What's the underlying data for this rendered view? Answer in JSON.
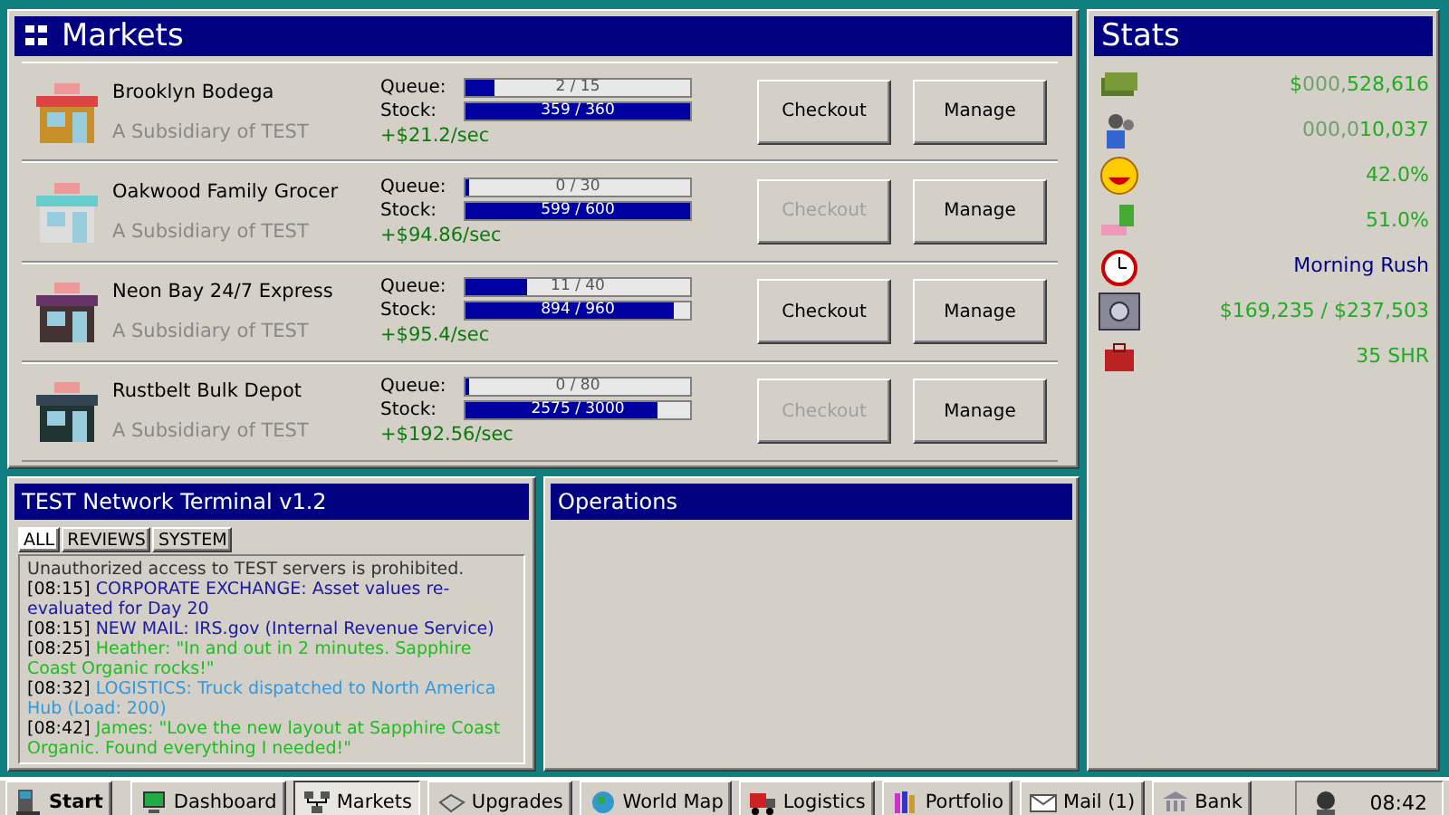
{
  "markets": {
    "title": "Markets",
    "stores": [
      {
        "kind": "bodega",
        "name": "Brooklyn Bodega",
        "subtitle": "A Subsidiary of TEST",
        "queue": {
          "label": "Queue:",
          "text": "2 / 15",
          "level": 0.133
        },
        "stock": {
          "label": "Stock:",
          "text": "359 / 360",
          "level": 0.997
        },
        "income": "+$21.2/sec",
        "checkout": "Checkout",
        "checkout_disabled": false,
        "manage": "Manage"
      },
      {
        "kind": "grocer",
        "name": "Oakwood Family Grocer",
        "subtitle": "A Subsidiary of TEST",
        "queue": {
          "label": "Queue:",
          "text": "0 / 30",
          "level": 0
        },
        "stock": {
          "label": "Stock:",
          "text": "599 / 600",
          "level": 0.998
        },
        "income": "+$94.86/sec",
        "checkout": "Checkout",
        "checkout_disabled": true,
        "manage": "Manage"
      },
      {
        "kind": "express",
        "name": "Neon Bay 24/7 Express",
        "subtitle": "A Subsidiary of TEST",
        "queue": {
          "label": "Queue:",
          "text": "11 / 40",
          "level": 0.275
        },
        "stock": {
          "label": "Stock:",
          "text": "894 / 960",
          "level": 0.931
        },
        "income": "+$95.4/sec",
        "checkout": "Checkout",
        "checkout_disabled": false,
        "manage": "Manage"
      },
      {
        "kind": "depot",
        "name": "Rustbelt Bulk Depot",
        "subtitle": "A Subsidiary of TEST",
        "queue": {
          "label": "Queue:",
          "text": "0 / 80",
          "level": 0
        },
        "stock": {
          "label": "Stock:",
          "text": "2575 / 3000",
          "level": 0.858
        },
        "income": "+$192.56/sec",
        "checkout": "Checkout",
        "checkout_disabled": true,
        "manage": "Manage"
      }
    ]
  },
  "stats": {
    "title": "Stats",
    "items": [
      {
        "kind": "money",
        "parts": [
          {
            "text": "$",
            "faded": false
          },
          {
            "text": "000,",
            "faded": true
          },
          {
            "text": "528,616",
            "faded": false
          }
        ]
      },
      {
        "kind": "money",
        "parts": [
          {
            "text": "000,0",
            "faded": true
          },
          {
            "text": "10,037",
            "faded": false
          }
        ]
      },
      {
        "kind": "money",
        "parts": [
          {
            "text": "42.0%",
            "faded": false
          }
        ]
      },
      {
        "kind": "money",
        "parts": [
          {
            "text": "51.0%",
            "faded": false
          }
        ]
      },
      {
        "kind": "phase",
        "parts": [
          {
            "text": "Morning Rush",
            "faded": false
          }
        ]
      },
      {
        "kind": "money",
        "parts": [
          {
            "text": "$169,235 / $237,503",
            "faded": false
          }
        ]
      },
      {
        "kind": "money",
        "parts": [
          {
            "text": "35 SHR",
            "faded": false
          }
        ]
      }
    ]
  },
  "terminal": {
    "title": "TEST Network Terminal v1.2",
    "tabs": [
      {
        "label": "ALL",
        "selected": true
      },
      {
        "label": "REVIEWS",
        "selected": false
      },
      {
        "label": "SYSTEM",
        "selected": false
      }
    ],
    "lines": [
      {
        "kind": "plain",
        "text": "Unauthorized access to TEST servers is prohibited."
      },
      {
        "kind": "system",
        "time": "[08:15]",
        "text": "CORPORATE EXCHANGE: Asset values re-evaluated for Day 20"
      },
      {
        "kind": "system",
        "time": "[08:15]",
        "text": "NEW MAIL: IRS.gov (Internal Revenue Service)"
      },
      {
        "kind": "review",
        "time": "[08:25]",
        "text": "Heather: \"In and out in 2 minutes. Sapphire Coast Organic rocks!\""
      },
      {
        "kind": "logistics",
        "time": "[08:32]",
        "text": "LOGISTICS: Truck dispatched to North America Hub (Load: 200)"
      },
      {
        "kind": "review",
        "time": "[08:42]",
        "text": "James: \"Love the new layout at Sapphire Coast Organic. Found everything I needed!\""
      }
    ]
  },
  "operations": {
    "title": "Operations"
  },
  "taskbar": {
    "start": "Start",
    "items": [
      {
        "label": "Dashboard",
        "selected": false
      },
      {
        "label": "Markets",
        "selected": true
      },
      {
        "label": "Upgrades",
        "selected": false
      },
      {
        "label": "World Map",
        "selected": false
      },
      {
        "label": "Logistics",
        "selected": false
      },
      {
        "label": "Portfolio",
        "selected": false
      },
      {
        "label": "Mail (1)",
        "selected": false
      },
      {
        "label": "Bank",
        "selected": false
      }
    ],
    "clock": "08:42"
  }
}
